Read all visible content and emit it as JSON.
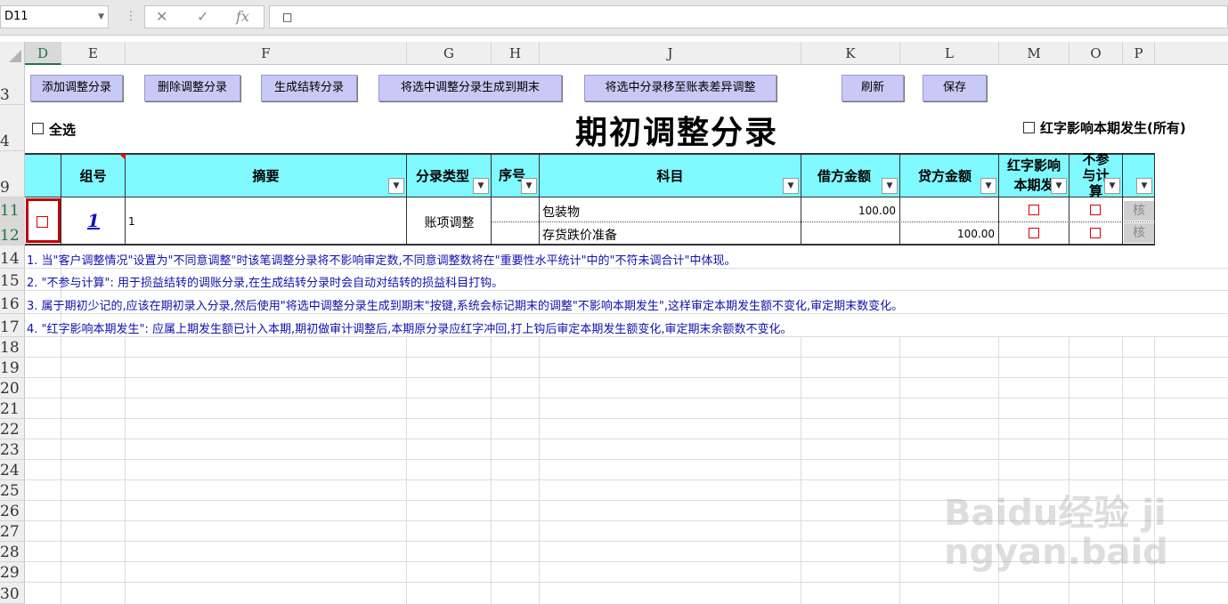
{
  "formula_bar": {
    "cell_ref": "D11",
    "value": "□"
  },
  "columns": [
    "D",
    "E",
    "F",
    "G",
    "H",
    "J",
    "K",
    "L",
    "M",
    "O",
    "P"
  ],
  "rows": [
    "3",
    "4",
    "9",
    "11",
    "12",
    "14",
    "15",
    "16",
    "17",
    "18",
    "19",
    "20",
    "21",
    "22",
    "23",
    "24",
    "25",
    "26",
    "27",
    "28",
    "29",
    "30"
  ],
  "toolbar": {
    "add": "添加调整分录",
    "delete": "删除调整分录",
    "generate": "生成结转分录",
    "to_end": "将选中调整分录生成到期末",
    "move_diff": "将选中分录移至账表差异调整",
    "refresh": "刷新",
    "save": "保存"
  },
  "select_all_label": "全选",
  "title": "期初调整分录",
  "red_option_label": "红字影响本期发生(所有)",
  "table_headers": {
    "group": "组号",
    "summary": "摘要",
    "type": "分录类型",
    "seq": "序号",
    "subject": "科目",
    "debit": "借方金额",
    "credit": "贷方金额",
    "red_affect": "红字影响本期发",
    "not_calc": "不参与计算"
  },
  "entry": {
    "group": "1",
    "summary": "1",
    "type": "账项调整",
    "lines": [
      {
        "subject": "包装物",
        "debit": "100.00",
        "credit": "",
        "check": "核"
      },
      {
        "subject": "存货跌价准备",
        "debit": "",
        "credit": "100.00",
        "check": "核"
      }
    ]
  },
  "notes": [
    "1. 当\"客户调整情况\"设置为\"不同意调整\"时该笔调整分录将不影响审定数,不同意调整数将在\"重要性水平统计\"中的\"不符未调合计\"中体现。",
    "2. \"不参与计算\": 用于损益结转的调账分录,在生成结转分录时会自动对结转的损益科目打钩。",
    "3. 属于期初少记的,应该在期初录入分录,然后使用\"将选中调整分录生成到期末\"按键,系统会标记期末的调整\"不影响本期发生\",这样审定本期发生额不变化,审定期末数变化。",
    "4. \"红字影响本期发生\": 应属上期发生额已计入本期,期初做审计调整后,本期原分录应红字冲回,打上钩后审定本期发生额变化,审定期末余额数不变化。"
  ],
  "watermark": "Baidu经验 jingyan.baidu.com"
}
